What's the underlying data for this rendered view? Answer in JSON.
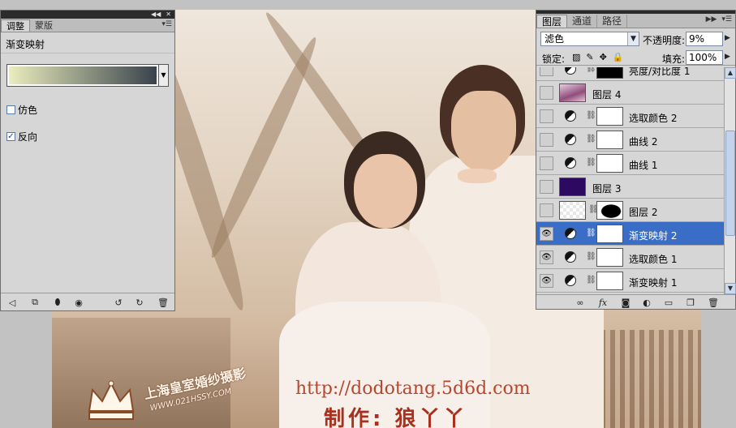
{
  "adjustments_panel": {
    "tabs": [
      "调整",
      "蒙版"
    ],
    "title": "渐变映射",
    "gradient": {
      "start_color": "#eaedbd",
      "end_color": "#39424c"
    },
    "options": [
      {
        "label": "仿色",
        "checked": false
      },
      {
        "label": "反向",
        "checked": true
      }
    ],
    "footer_icons": [
      "back-arrow-icon",
      "expand-view-icon",
      "clip-to-layer-icon",
      "visibility-eye-icon",
      "view-previous-icon",
      "reset-icon",
      "trash-icon"
    ]
  },
  "layers_panel": {
    "tabs": [
      "图层",
      "通道",
      "路径"
    ],
    "blend_mode": "滤色",
    "opacity_label": "不透明度:",
    "opacity_value": "9%",
    "lock_label": "锁定:",
    "fill_label": "填充:",
    "fill_value": "100%",
    "layers": [
      {
        "name": "亮度/对比度 1",
        "kind": "adjustment",
        "mask": "black",
        "visible": false,
        "selected": false
      },
      {
        "name": "图层 4",
        "kind": "pixel",
        "thumb": "pink",
        "visible": false,
        "selected": false
      },
      {
        "name": "选取颜色 2",
        "kind": "adjustment",
        "mask": "white",
        "visible": false,
        "selected": false
      },
      {
        "name": "曲线 2",
        "kind": "adjustment",
        "mask": "white",
        "visible": false,
        "selected": false
      },
      {
        "name": "曲线 1",
        "kind": "adjustment",
        "mask": "white",
        "visible": false,
        "selected": false
      },
      {
        "name": "图层 3",
        "kind": "pixel",
        "thumb": "purple",
        "visible": false,
        "selected": false
      },
      {
        "name": "图层 2",
        "kind": "pixel-mask",
        "thumb": "checker",
        "mask": "blob",
        "visible": false,
        "selected": false
      },
      {
        "name": "渐变映射 2",
        "kind": "adjustment",
        "mask": "white",
        "visible": true,
        "selected": true
      },
      {
        "name": "选取颜色 1",
        "kind": "adjustment",
        "mask": "white",
        "visible": true,
        "selected": false
      },
      {
        "name": "渐变映射 1",
        "kind": "adjustment",
        "mask": "white",
        "visible": true,
        "selected": false
      }
    ]
  },
  "canvas": {
    "watermark_url": "http://dodotang.5d6d.com",
    "watermark_credit": "制作: 狼丫丫",
    "studio_name": "上海皇室婚纱摄影",
    "studio_url": "WWW.021HSSY.COM"
  },
  "colors": {
    "selection": "#3a6ec6",
    "panel_bg": "#d6d6d6",
    "workspace_bg": "#c2c2c2",
    "watermark": "#b9462c"
  }
}
